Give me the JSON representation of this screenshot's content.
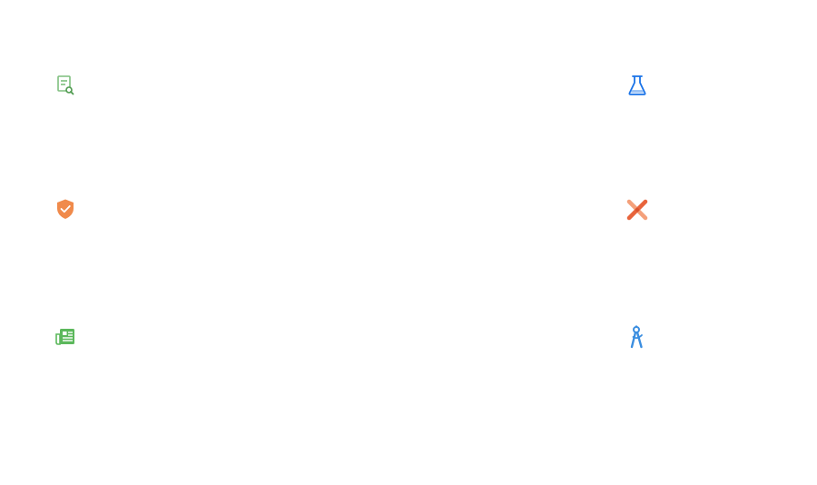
{
  "icons": [
    {
      "id": "doc",
      "name": "document-search-icon",
      "color": "#7fbf7f"
    },
    {
      "id": "flask",
      "name": "flask-icon",
      "color": "#1a73e8"
    },
    {
      "id": "shield",
      "name": "shield-check-icon",
      "color": "#f08a4b"
    },
    {
      "id": "tools",
      "name": "crossed-tools-icon",
      "color": "#f0845a"
    },
    {
      "id": "news",
      "name": "newspaper-icon",
      "color": "#5cb85c"
    },
    {
      "id": "compass",
      "name": "drafting-compass-icon",
      "color": "#3b8ee0"
    }
  ]
}
